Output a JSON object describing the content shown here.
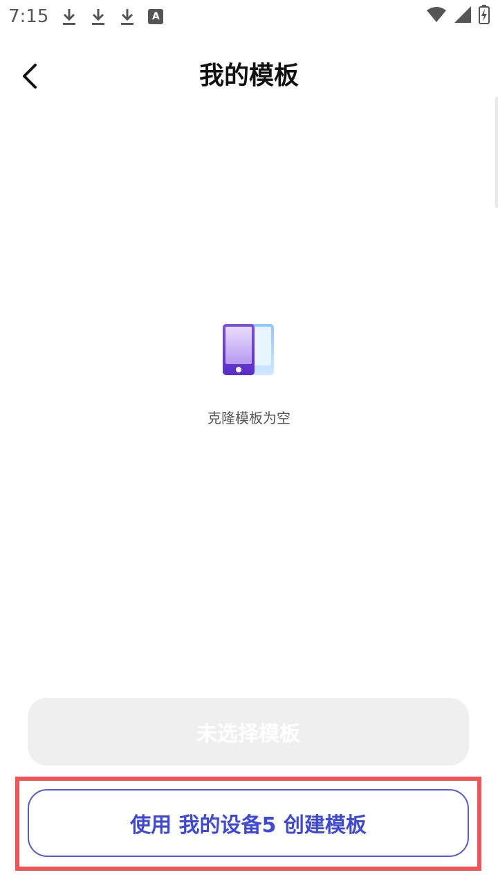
{
  "status_bar": {
    "time": "7:15",
    "badge_letter": "A",
    "icons": [
      "download-icon",
      "download-icon",
      "download-icon",
      "font-icon",
      "wifi-icon",
      "signal-icon",
      "battery-charging-icon"
    ]
  },
  "header": {
    "title": "我的模板",
    "back_icon": "chevron-left-icon"
  },
  "empty_state": {
    "icon": "phones-icon",
    "message": "克隆模板为空"
  },
  "actions": {
    "disabled_label": "未选择模板",
    "create_label": "使用 我的设备5 创建模板"
  },
  "colors": {
    "accent": "#3f49d8",
    "highlight": "#f05454",
    "disabled_bg": "#efefef",
    "phone_front": "#6b3fd6",
    "phone_back": "#9fd3ff"
  }
}
